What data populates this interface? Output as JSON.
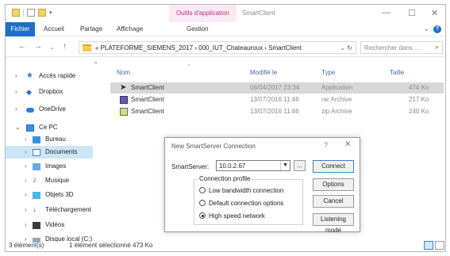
{
  "titlebar": {
    "contextual_tab": "Outils d'application",
    "window_title": "SmartClient",
    "min_label": "—",
    "max_label": "☐",
    "close_label": "✕"
  },
  "ribbon": {
    "tabs": [
      "Fichier",
      "Accueil",
      "Partage",
      "Affichage",
      "Gestion"
    ],
    "help_label": "?"
  },
  "address": {
    "crumb": "« PLATEFORME_SIEMENS_2017 › 000_IUT_Chateauroux › SmartClient",
    "refresh_label": "⌄ ↻",
    "search_placeholder": "Rechercher dans ..."
  },
  "nav": {
    "items": [
      {
        "label": "Accès rapide",
        "icon": "star-icon"
      },
      {
        "label": "Dropbox",
        "icon": "dropbox-icon"
      },
      {
        "label": "OneDrive",
        "icon": "cloud-icon"
      },
      {
        "label": "Ce PC",
        "icon": "pc-icon"
      },
      {
        "label": "Bureau",
        "icon": "desktop-icon"
      },
      {
        "label": "Documents",
        "icon": "documents-icon"
      },
      {
        "label": "Images",
        "icon": "images-icon"
      },
      {
        "label": "Musique",
        "icon": "music-icon"
      },
      {
        "label": "Objets 3D",
        "icon": "objects-3d-icon"
      },
      {
        "label": "Téléchargement",
        "icon": "download-icon"
      },
      {
        "label": "Vidéos",
        "icon": "video-icon"
      },
      {
        "label": "Disque local (C:)",
        "icon": "drive-icon"
      }
    ]
  },
  "list": {
    "columns": [
      "Nom",
      "Modifié le",
      "Type",
      "Taille"
    ],
    "rows": [
      {
        "name": "SmartClient",
        "modified": "06/04/2017 23:34",
        "type": "Application",
        "size": "474 Ko"
      },
      {
        "name": "SmartClient",
        "modified": "13/07/2016 11:46",
        "type": "rar Archive",
        "size": "217 Ko"
      },
      {
        "name": "SmartClient",
        "modified": "13/07/2016 11:46",
        "type": "zip Archive",
        "size": "240 Ko"
      }
    ]
  },
  "dialog": {
    "title": "New SmartServer Connection",
    "help_label": "?",
    "close_label": "✕",
    "server_label": "SmartServer:",
    "server_value": "10.0.2.67",
    "browse_label": "...",
    "connect_label": "Connect",
    "options_label": "Options",
    "cancel_label": "Cancel",
    "listening_label": "Listening mode",
    "profile_title": "Connection profile",
    "profiles": [
      {
        "label": "Low bandwidth connection",
        "selected": false
      },
      {
        "label": "Default connection options",
        "selected": false
      },
      {
        "label": "High speed network",
        "selected": true
      }
    ]
  },
  "status": {
    "count": "3 élément(s)",
    "selection": "1 élément sélectionné  473 Ko"
  }
}
